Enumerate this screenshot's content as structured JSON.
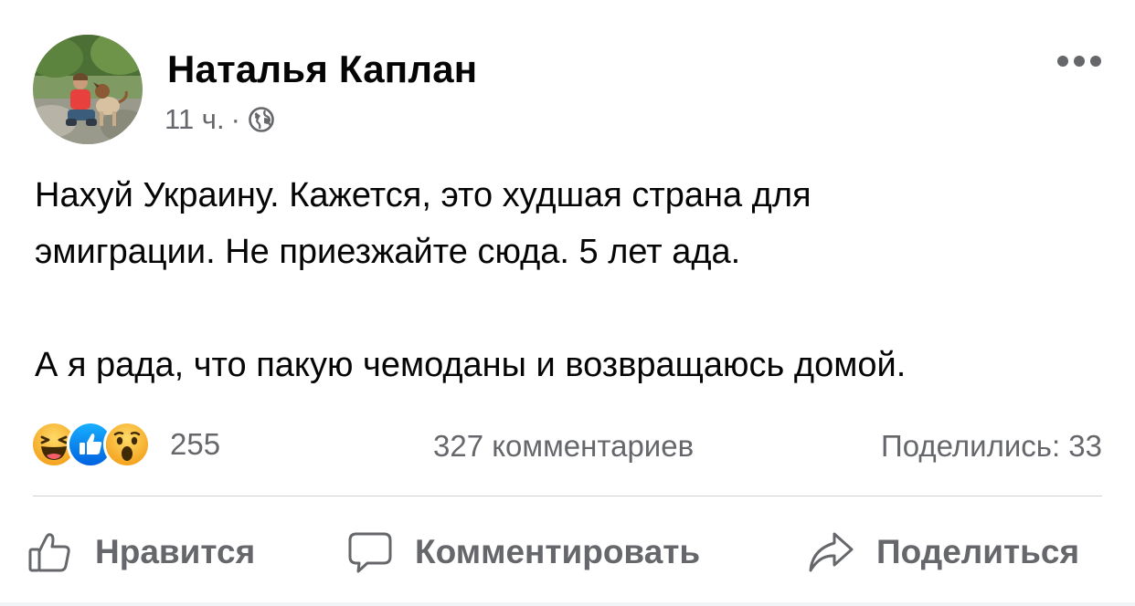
{
  "author": {
    "name": "Наталья Каплан",
    "time": "11 ч.",
    "separator": "·",
    "audience_icon": "globe-icon"
  },
  "post": {
    "paragraphs": [
      [
        "Нахуй Украину. Кажется, это худшая страна для",
        "эмиграции. Не приезжайте сюда. 5 лет ада."
      ],
      [
        "А я рада, что пакую чемоданы и возвращаюсь домой."
      ]
    ]
  },
  "stats": {
    "reaction_icons": [
      "haha-icon",
      "like-icon",
      "wow-icon"
    ],
    "reactions_count": "255",
    "comments_count": "327 комментариев",
    "shares_count": "Поделились: 33"
  },
  "actions": {
    "like": "Нравится",
    "comment": "Комментировать",
    "share": "Поделиться"
  },
  "colors": {
    "text": "#050505",
    "secondary_text": "#65676b",
    "divider": "#ced0d4",
    "like_blue": "#1877f2",
    "reaction_yellow": "#f7b125"
  }
}
